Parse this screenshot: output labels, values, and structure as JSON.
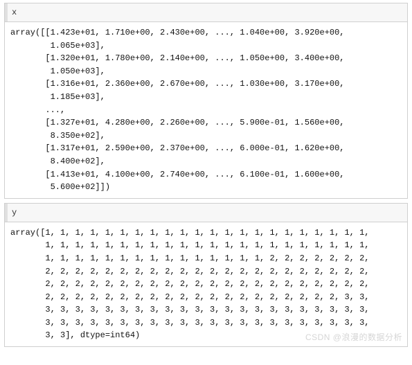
{
  "cell1": {
    "input": "x",
    "output_lines": [
      "array([[1.423e+01, 1.710e+00, 2.430e+00, ..., 1.040e+00, 3.920e+00,",
      "        1.065e+03],",
      "       [1.320e+01, 1.780e+00, 2.140e+00, ..., 1.050e+00, 3.400e+00,",
      "        1.050e+03],",
      "       [1.316e+01, 2.360e+00, 2.670e+00, ..., 1.030e+00, 3.170e+00,",
      "        1.185e+03],",
      "       ...,",
      "       [1.327e+01, 4.280e+00, 2.260e+00, ..., 5.900e-01, 1.560e+00,",
      "        8.350e+02],",
      "       [1.317e+01, 2.590e+00, 2.370e+00, ..., 6.000e-01, 1.620e+00,",
      "        8.400e+02],",
      "       [1.413e+01, 4.100e+00, 2.740e+00, ..., 6.100e-01, 1.600e+00,",
      "        5.600e+02]])"
    ]
  },
  "cell2": {
    "input": "y",
    "output_lines": [
      "array([1, 1, 1, 1, 1, 1, 1, 1, 1, 1, 1, 1, 1, 1, 1, 1, 1, 1, 1, 1, 1, 1,",
      "       1, 1, 1, 1, 1, 1, 1, 1, 1, 1, 1, 1, 1, 1, 1, 1, 1, 1, 1, 1, 1, 1,",
      "       1, 1, 1, 1, 1, 1, 1, 1, 1, 1, 1, 1, 1, 1, 1, 2, 2, 2, 2, 2, 2, 2,",
      "       2, 2, 2, 2, 2, 2, 2, 2, 2, 2, 2, 2, 2, 2, 2, 2, 2, 2, 2, 2, 2, 2,",
      "       2, 2, 2, 2, 2, 2, 2, 2, 2, 2, 2, 2, 2, 2, 2, 2, 2, 2, 2, 2, 2, 2,",
      "       2, 2, 2, 2, 2, 2, 2, 2, 2, 2, 2, 2, 2, 2, 2, 2, 2, 2, 2, 2, 3, 3,",
      "       3, 3, 3, 3, 3, 3, 3, 3, 3, 3, 3, 3, 3, 3, 3, 3, 3, 3, 3, 3, 3, 3,",
      "       3, 3, 3, 3, 3, 3, 3, 3, 3, 3, 3, 3, 3, 3, 3, 3, 3, 3, 3, 3, 3, 3,",
      "       3, 3], dtype=int64)"
    ]
  },
  "watermark": "CSDN @浪漫的数据分析"
}
